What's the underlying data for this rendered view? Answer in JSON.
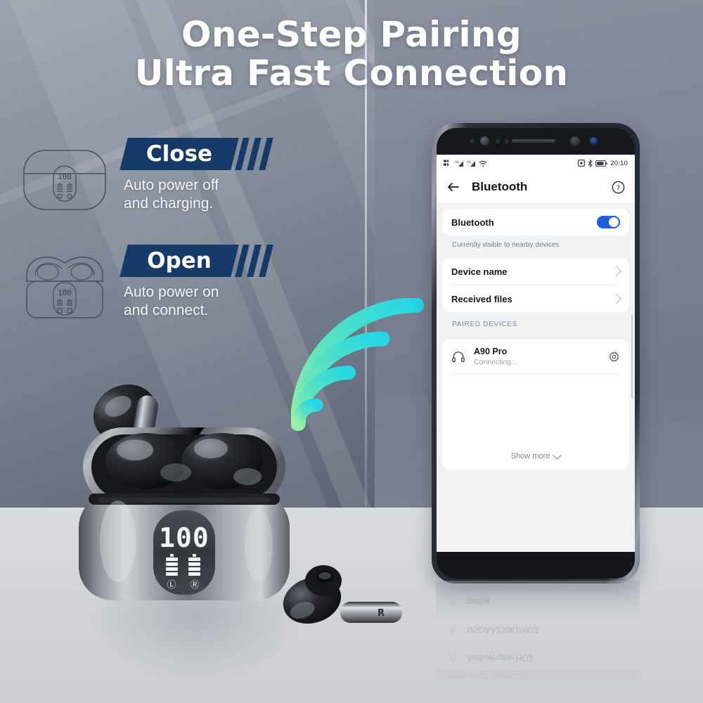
{
  "headline": {
    "line1": "One-Step Pairing",
    "line2": "Ultra Fast Connection"
  },
  "colors": {
    "badge_navy": "#163a68",
    "toggle_blue": "#1f5fe0",
    "signal_cyan": "#2fd8e0",
    "signal_green": "#8ef0a0",
    "panel_left": "#7e8795",
    "panel_right": "#757d8e",
    "floor": "#d4d6da"
  },
  "features": [
    {
      "badge": "Close",
      "description": "Auto power off\nand charging.",
      "desc_line1": "Auto power off",
      "desc_line2": "and charging.",
      "icon": "earbuds-case-closed-icon",
      "led_value": "100"
    },
    {
      "badge": "Open",
      "description": "Auto power on\nand connect.",
      "desc_line1": "Auto power on",
      "desc_line2": "and connect.",
      "icon": "earbuds-case-open-icon",
      "led_value": "100"
    }
  ],
  "product": {
    "case_display_value": "100",
    "left_bud_label": "L",
    "right_bud_label": "R",
    "loose_bud_label": "R"
  },
  "phone": {
    "status_bar": {
      "time": "20:10",
      "left_icons": [
        "sim-dual-icon",
        "signal-bars-icon",
        "signal-bars-icon",
        "wifi-icon"
      ],
      "right_icons": [
        "alarm-icon",
        "bluetooth-icon",
        "battery-icon"
      ]
    },
    "app_bar": {
      "back": "back-arrow-icon",
      "title": "Bluetooth",
      "help": "help-icon"
    },
    "bluetooth_toggle": {
      "label": "Bluetooth",
      "state": "on"
    },
    "visibility_hint": "Currently visible to nearby devices",
    "settings_rows": [
      {
        "label": "Device name"
      },
      {
        "label": "Received files"
      }
    ],
    "paired_section_label": "PAIRED DEVICES",
    "paired_devices": [
      {
        "name": "A90 Pro",
        "status": "Connecting...",
        "icon": "headphones-icon",
        "action_icon": "gear-icon"
      }
    ],
    "show_more": "Show more"
  },
  "reflection": {
    "rows": [
      {
        "name": "midea",
        "icon": "bluetooth-icon"
      },
      {
        "name": "NSDAA230810403",
        "icon": "bluetooth-icon"
      },
      {
        "name": "Audioengine HD3",
        "icon": "headphones-icon"
      }
    ],
    "section_label": "AVAILABLE DEVICES"
  }
}
